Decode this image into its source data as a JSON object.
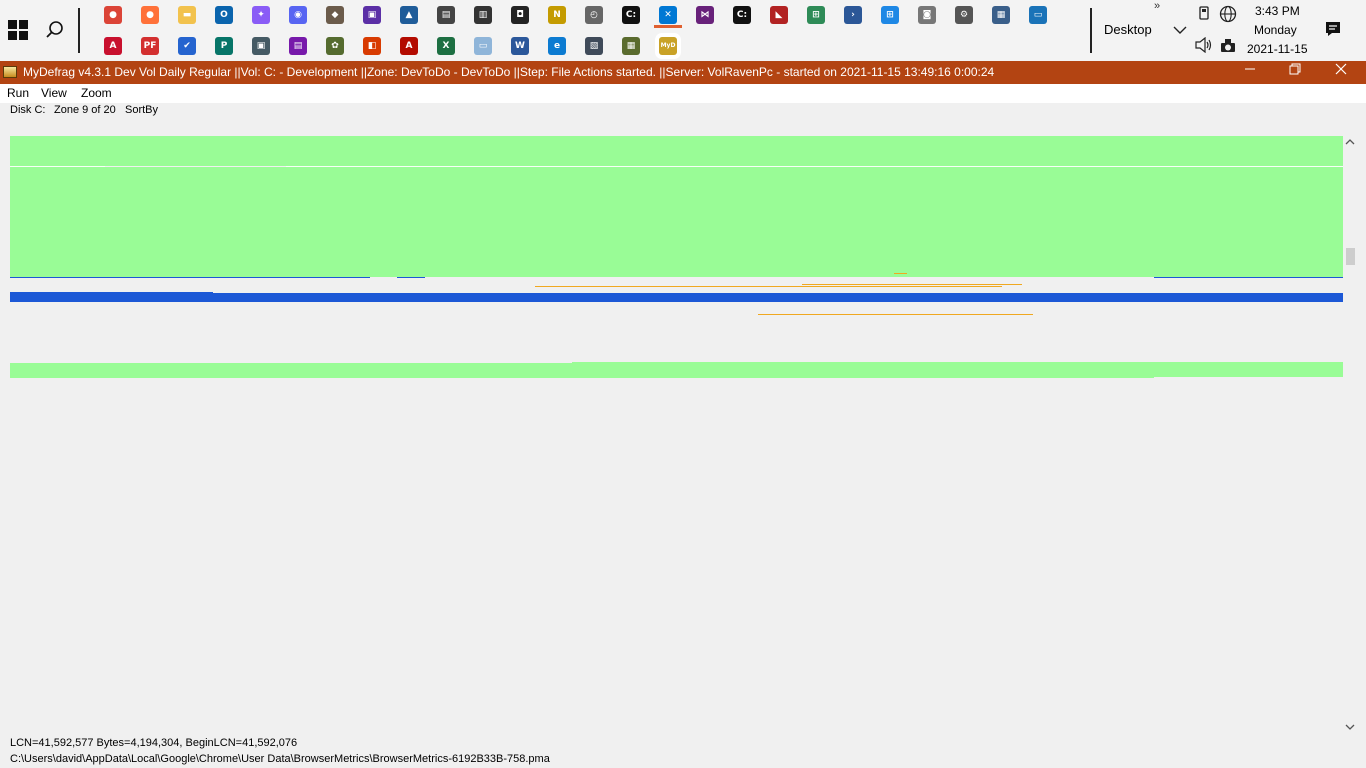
{
  "taskbar": {
    "pinned_row1": [
      {
        "name": "chrome-icon",
        "color": "#db4437",
        "glyph": "●"
      },
      {
        "name": "firefox-icon",
        "color": "#ff7139",
        "glyph": "●"
      },
      {
        "name": "file-explorer-icon",
        "color": "#f2c24d",
        "glyph": "▬"
      },
      {
        "name": "outlook-icon",
        "color": "#0a64ad",
        "glyph": "O"
      },
      {
        "name": "messenger-icon",
        "color": "#8a5cf6",
        "glyph": "✦"
      },
      {
        "name": "discord-icon",
        "color": "#5865f2",
        "glyph": "◉"
      },
      {
        "name": "gimp-icon",
        "color": "#6b5b4b",
        "glyph": "◆"
      },
      {
        "name": "powertoys-icon",
        "color": "#5b2fa6",
        "glyph": "▣"
      },
      {
        "name": "photo-editor-icon",
        "color": "#1f5c99",
        "glyph": "▲"
      },
      {
        "name": "printer-tool-icon",
        "color": "#444444",
        "glyph": "▤"
      },
      {
        "name": "scanner-icon",
        "color": "#333333",
        "glyph": "▥"
      },
      {
        "name": "camera-icon",
        "color": "#222222",
        "glyph": "◘"
      },
      {
        "name": "notepad-icon",
        "color": "#c49b00",
        "glyph": "N"
      },
      {
        "name": "clock-app-icon",
        "color": "#666666",
        "glyph": "◴"
      },
      {
        "name": "command-prompt-icon",
        "color": "#111111",
        "glyph": "C:"
      },
      {
        "name": "vscode-icon",
        "color": "#0078d4",
        "glyph": "✕"
      },
      {
        "name": "visual-studio-icon",
        "color": "#68217a",
        "glyph": "⋈"
      },
      {
        "name": "command-prompt-2-icon",
        "color": "#111111",
        "glyph": "C:"
      },
      {
        "name": "ruler-tool-icon",
        "color": "#b22222",
        "glyph": "◣"
      },
      {
        "name": "windows-tool-icon",
        "color": "#2e8b57",
        "glyph": "⊞"
      },
      {
        "name": "powershell-icon",
        "color": "#2b5797",
        "glyph": "›"
      },
      {
        "name": "network-tool-icon",
        "color": "#1e88e5",
        "glyph": "⊞"
      },
      {
        "name": "remote-tool-icon",
        "color": "#777777",
        "glyph": "◙"
      },
      {
        "name": "settings-icon",
        "color": "#555555",
        "glyph": "⚙"
      },
      {
        "name": "admin-tool-icon",
        "color": "#3a5f8a",
        "glyph": "▦"
      },
      {
        "name": "remote-desktop-icon",
        "color": "#1a73b8",
        "glyph": "▭"
      }
    ],
    "pinned_row2": [
      {
        "name": "acrobat-reader-icon",
        "color": "#c8102e",
        "glyph": "A"
      },
      {
        "name": "pdf-tool-icon",
        "color": "#d32f2f",
        "glyph": "PF"
      },
      {
        "name": "todo-icon",
        "color": "#2564cf",
        "glyph": "✔"
      },
      {
        "name": "publisher-icon",
        "color": "#077568",
        "glyph": "P"
      },
      {
        "name": "monitor-tool-icon",
        "color": "#455a64",
        "glyph": "▣"
      },
      {
        "name": "onenote-tool-icon",
        "color": "#7719aa",
        "glyph": "▤"
      },
      {
        "name": "plant-app-icon",
        "color": "#556b2f",
        "glyph": "✿"
      },
      {
        "name": "office-icon",
        "color": "#d83b01",
        "glyph": "◧"
      },
      {
        "name": "acrobat-icon",
        "color": "#b30b00",
        "glyph": "A"
      },
      {
        "name": "excel-icon",
        "color": "#1d6f42",
        "glyph": "X"
      },
      {
        "name": "notes-icon",
        "color": "#8fb5d9",
        "glyph": "▭"
      },
      {
        "name": "word-icon",
        "color": "#2b579a",
        "glyph": "W"
      },
      {
        "name": "edge-icon",
        "color": "#0c7bd1",
        "glyph": "e"
      },
      {
        "name": "backup-tool-icon",
        "color": "#3f4a59",
        "glyph": "▧"
      },
      {
        "name": "spreadsheet-tool-icon",
        "color": "#5a6b2e",
        "glyph": "▦"
      },
      {
        "name": "mydefrag-icon",
        "color": "#c9a227",
        "glyph": "MyD"
      }
    ],
    "desktop_label": "Desktop",
    "overflow_chevron": "»",
    "clock": {
      "time": "3:43 PM",
      "day": "Monday",
      "date": "2021-11-15"
    }
  },
  "window": {
    "title": "MyDefrag v4.3.1   Dev Vol Daily Regular ||Vol: C: - Development ||Zone: DevToDo - DevToDo ||Step: File Actions started. ||Server: VolRavenPc -  started on 2021-11-15 13:49:16 0:00:24"
  },
  "menu": {
    "run": "Run",
    "view": "View",
    "zoom": "Zoom"
  },
  "status": {
    "disk": "Disk C:",
    "zone": "Zone 9 of 20",
    "sort": "SortBy"
  },
  "diskmap": {
    "colors": {
      "green": "#99fc96",
      "blue": "#1c58d6",
      "orange": "#f0a820",
      "background": "#f0f0f0"
    }
  },
  "info": {
    "line1": "LCN=41,592,577     Bytes=4,194,304, BeginLCN=41,592,076",
    "line2": "C:\\Users\\david\\AppData\\Local\\Google\\Chrome\\User Data\\BrowserMetrics\\BrowserMetrics-6192B33B-758.pma"
  }
}
